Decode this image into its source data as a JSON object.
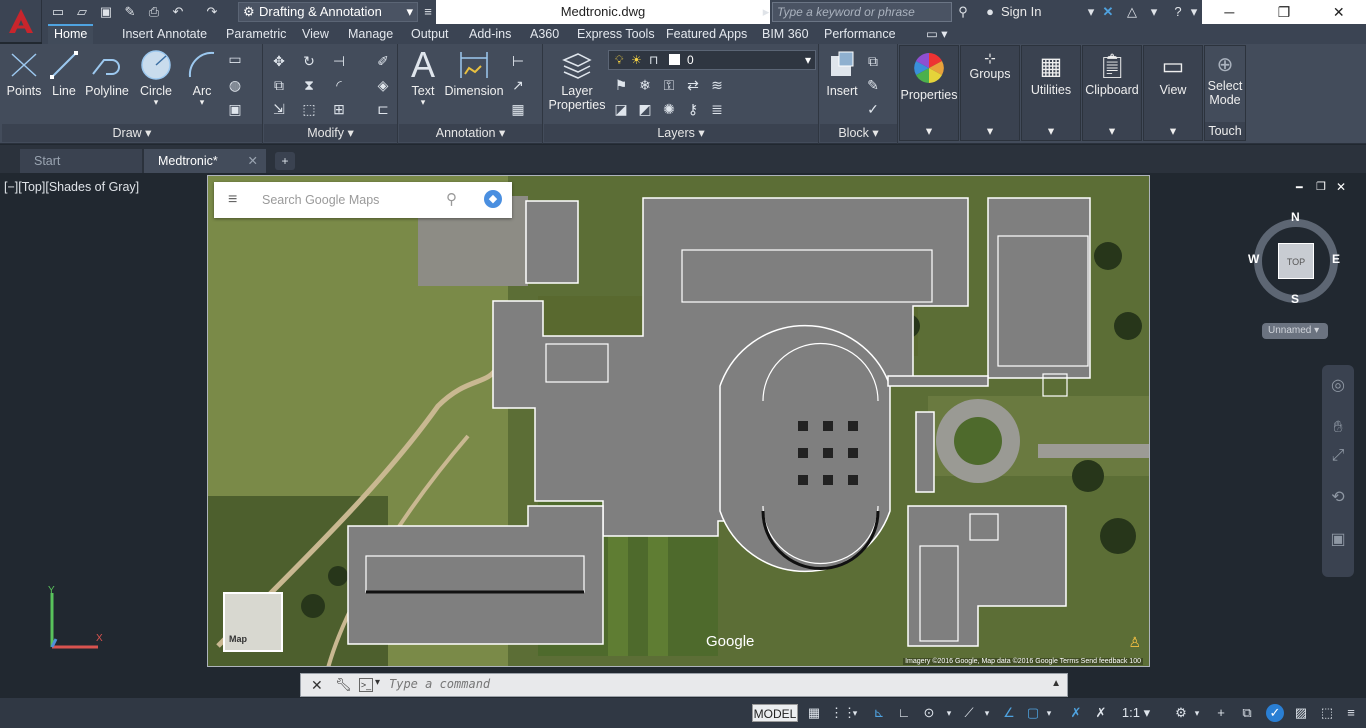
{
  "title_bar": {
    "workspace": "Drafting & Annotation",
    "document_title": "Medtronic.dwg",
    "search_placeholder": "Type a keyword or phrase",
    "sign_in": "Sign In"
  },
  "ribbon_tabs": [
    "Home",
    "Insert",
    "Annotate",
    "Parametric",
    "View",
    "Manage",
    "Output",
    "Add-ins",
    "A360",
    "Express Tools",
    "Featured Apps",
    "BIM 360",
    "Performance"
  ],
  "active_tab": "Home",
  "panels": {
    "draw": {
      "title": "Draw",
      "tools": [
        "Points",
        "Line",
        "Polyline",
        "Circle",
        "Arc"
      ]
    },
    "modify": {
      "title": "Modify"
    },
    "annotation": {
      "title": "Annotation",
      "tools": [
        "Text",
        "Dimension"
      ]
    },
    "layers": {
      "title": "Layers",
      "tool_line1": "Layer",
      "tool_line2": "Properties",
      "current_layer": "0"
    },
    "block": {
      "title": "Block",
      "tool": "Insert"
    },
    "properties": "Properties",
    "groups": "Groups",
    "utilities": "Utilities",
    "clipboard": "Clipboard",
    "view": "View",
    "select_mode_line1": "Select",
    "select_mode_line2": "Mode",
    "touch": "Touch"
  },
  "doc_tabs": [
    {
      "label": "Start"
    },
    {
      "label": "Medtronic*"
    }
  ],
  "viewport": {
    "label": "[−][Top][Shades of Gray]",
    "map_search_placeholder": "Search Google Maps",
    "map_thumb_label": "Map",
    "google_logo": "Google",
    "map_footer": "Imagery ©2016 Google, Map data ©2016 Google    Terms    Send feedback    100",
    "viewcube": {
      "n": "N",
      "s": "S",
      "e": "E",
      "w": "W",
      "face": "TOP",
      "ucs": "Unnamed"
    }
  },
  "command_line": {
    "placeholder": "Type a command"
  },
  "status_bar": {
    "model": "MODEL",
    "scale": "1:1"
  },
  "colors": {
    "accent": "#4fa3e0",
    "ribbon_bg": "#434c5b",
    "titlebar_bg": "#3b4453",
    "app_red": "#c8252c"
  }
}
